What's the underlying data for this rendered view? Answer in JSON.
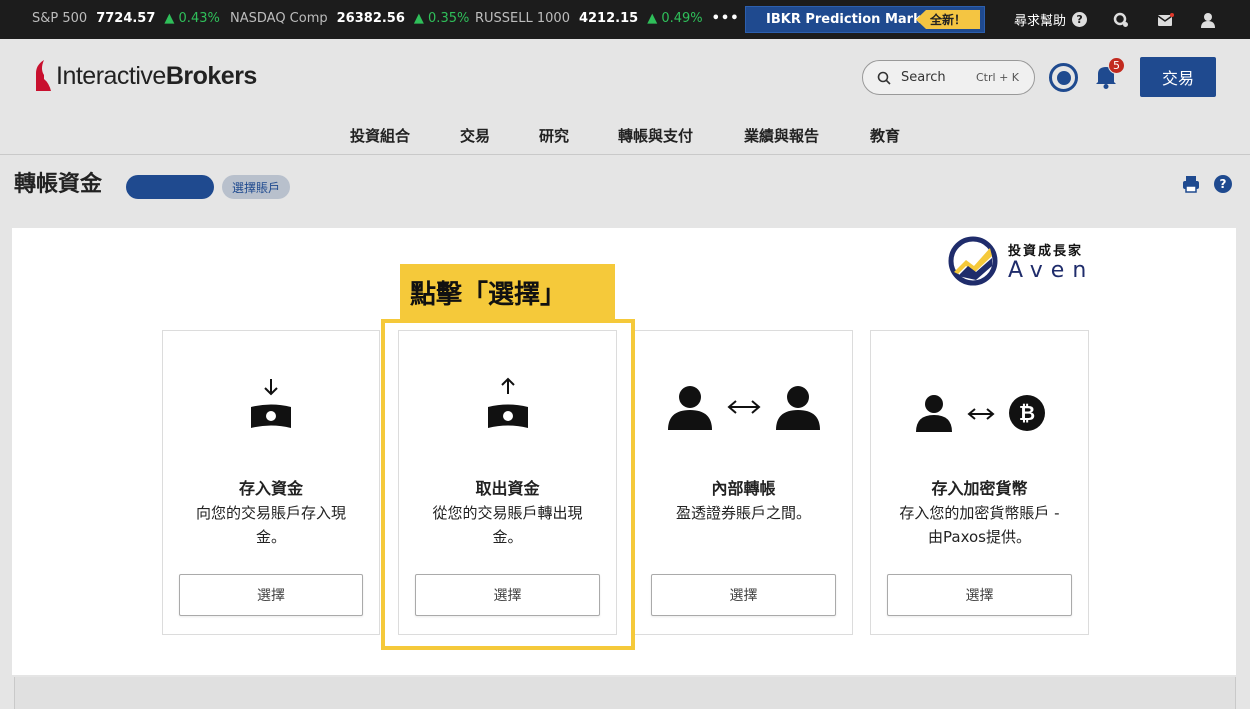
{
  "ticker": {
    "items": [
      {
        "name": "S&P 500",
        "value": "7724.57",
        "change": "▲ 0.43%"
      },
      {
        "name": "NASDAQ Comp",
        "value": "26382.56",
        "change": "▲ 0.35%"
      },
      {
        "name": "RUSSELL 1000",
        "value": "4212.15",
        "change": "▲ 0.49%"
      }
    ],
    "more": "•••",
    "promo_label": "IBKR Prediction Markets",
    "promo_badge": "全新！",
    "help_label": "尋求幫助",
    "help_icon": "?"
  },
  "header": {
    "logo_light": "Interactive",
    "logo_bold": "Brokers",
    "search_placeholder": "Search",
    "search_shortcut": "Ctrl + K",
    "notification_count": "5",
    "trade_button": "交易",
    "nav": [
      "投資組合",
      "交易",
      "研究",
      "轉帳與支付",
      "業績與報告",
      "教育"
    ]
  },
  "page": {
    "title": "轉帳資金",
    "select_account": "選擇賬戶",
    "help_icon": "?"
  },
  "watermark": {
    "cn": "投資成長家",
    "en": "Aven"
  },
  "callout": "點擊「選擇」",
  "cards": [
    {
      "title": "存入資金",
      "desc": "向您的交易賬戶存入現金。",
      "button": "選擇",
      "icon": "deposit-icon"
    },
    {
      "title": "取出資金",
      "desc": "從您的交易賬戶轉出現金。",
      "button": "選擇",
      "icon": "withdraw-icon"
    },
    {
      "title": "內部轉帳",
      "desc": "盈透證券賬戶之間。",
      "button": "選擇",
      "icon": "internal-transfer-icon"
    },
    {
      "title": "存入加密貨幣",
      "desc": "存入您的加密貨幣賬戶 -由Paxos提供。",
      "button": "選擇",
      "icon": "crypto-deposit-icon"
    }
  ],
  "colors": {
    "brand_blue": "#1f4a8f",
    "highlight": "#f5c93a",
    "positive": "#2fbf5a"
  }
}
